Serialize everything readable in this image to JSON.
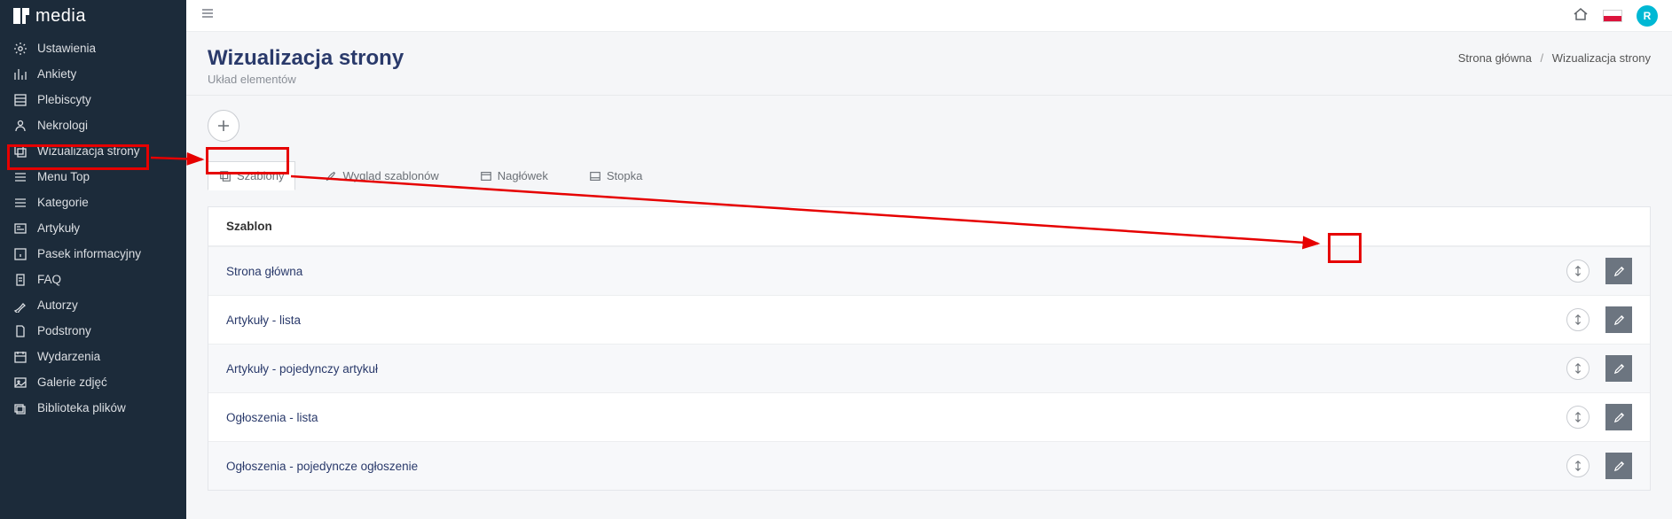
{
  "brand": {
    "name": "media"
  },
  "sidebar": {
    "items": [
      {
        "label": "Ustawienia",
        "icon": "gear"
      },
      {
        "label": "Ankiety",
        "icon": "chart"
      },
      {
        "label": "Plebiscyty",
        "icon": "grid"
      },
      {
        "label": "Nekrologi",
        "icon": "person"
      },
      {
        "label": "Wizualizacja strony",
        "icon": "layers"
      },
      {
        "label": "Menu Top",
        "icon": "list"
      },
      {
        "label": "Kategorie",
        "icon": "list"
      },
      {
        "label": "Artykuły",
        "icon": "news"
      },
      {
        "label": "Pasek informacyjny",
        "icon": "info"
      },
      {
        "label": "FAQ",
        "icon": "clipboard"
      },
      {
        "label": "Autorzy",
        "icon": "pen"
      },
      {
        "label": "Podstrony",
        "icon": "page"
      },
      {
        "label": "Wydarzenia",
        "icon": "calendar"
      },
      {
        "label": "Galerie zdjęć",
        "icon": "image"
      },
      {
        "label": "Biblioteka plików",
        "icon": "folder"
      }
    ]
  },
  "header": {
    "title": "Wizualizacja strony",
    "subtitle": "Układ elementów",
    "breadcrumb_home": "Strona główna",
    "breadcrumb_current": "Wizualizacja strony"
  },
  "tabs": [
    {
      "label": "Szablony"
    },
    {
      "label": "Wygląd szablonów"
    },
    {
      "label": "Nagłówek"
    },
    {
      "label": "Stopka"
    }
  ],
  "table": {
    "header": "Szablon",
    "rows": [
      {
        "name": "Strona główna"
      },
      {
        "name": "Artykuły - lista"
      },
      {
        "name": "Artykuły - pojedynczy artykuł"
      },
      {
        "name": "Ogłoszenia - lista"
      },
      {
        "name": "Ogłoszenia - pojedyncze ogłoszenie"
      }
    ]
  },
  "avatar": {
    "initial": "R"
  }
}
